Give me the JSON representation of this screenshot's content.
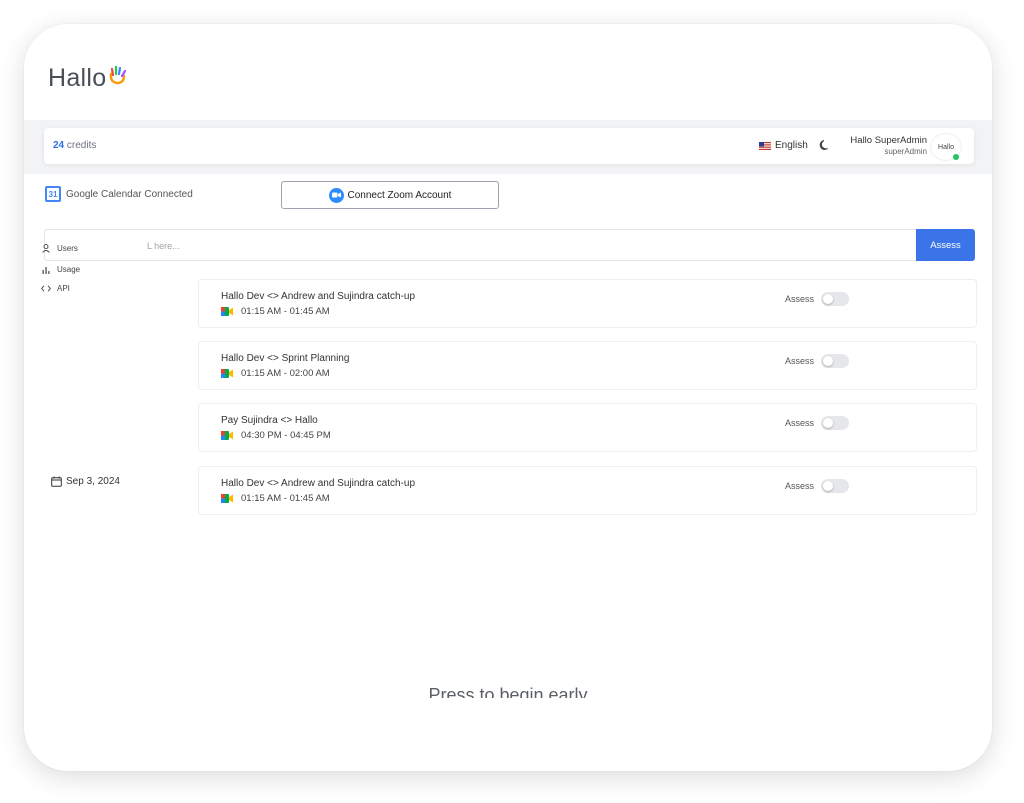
{
  "app": {
    "logo_text": "Hallo"
  },
  "topbar": {
    "credits_count": "24",
    "credits_label": "credits",
    "language": "English",
    "user_name": "Hallo SuperAdmin",
    "user_role": "superAdmin",
    "avatar_text": "Hallo"
  },
  "integrations": {
    "google_calendar_label": "Google Calendar Connected",
    "google_calendar_icon_text": "31",
    "zoom_button_label": "Connect Zoom Account"
  },
  "search": {
    "placeholder": "L here...",
    "button_label": "Assess"
  },
  "sidebar": {
    "items": [
      {
        "label": "Users",
        "icon": "user-icon"
      },
      {
        "label": "Usage",
        "icon": "bar-chart-icon"
      },
      {
        "label": "API",
        "icon": "code-icon"
      }
    ]
  },
  "date_label": "Sep 3, 2024",
  "meetings": [
    {
      "title": "Hallo Dev <> Andrew and Sujindra catch-up",
      "time": "01:15 AM - 01:45 AM",
      "assess_label": "Assess",
      "assess_on": false
    },
    {
      "title": "Hallo Dev <> Sprint Planning",
      "time": "01:15 AM - 02:00 AM",
      "assess_label": "Assess",
      "assess_on": false
    },
    {
      "title": "Pay Sujindra <> Hallo",
      "time": "04:30 PM - 04:45 PM",
      "assess_label": "Assess",
      "assess_on": false
    },
    {
      "title": "Hallo Dev <> Andrew and Sujindra catch-up",
      "time": "01:15 AM - 01:45 AM",
      "assess_label": "Assess",
      "assess_on": false
    }
  ],
  "footer_text": "Press to begin early",
  "colors": {
    "accent": "#3b73e8",
    "online": "#22c55e"
  }
}
